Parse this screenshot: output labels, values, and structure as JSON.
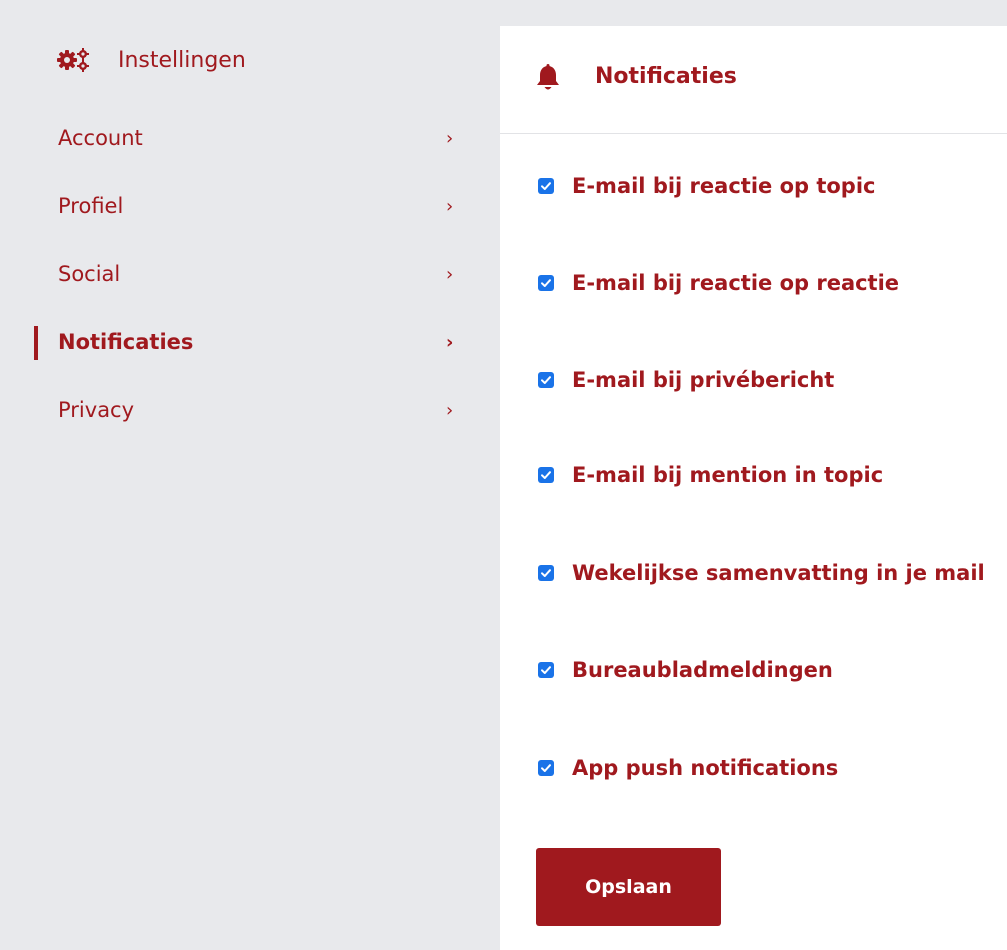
{
  "sidebar": {
    "header": {
      "icon": "gears-icon",
      "title": "Instellingen"
    },
    "items": [
      {
        "label": "Account",
        "chevron": "›",
        "active": false
      },
      {
        "label": "Profiel",
        "chevron": "›",
        "active": false
      },
      {
        "label": "Social",
        "chevron": "›",
        "active": false
      },
      {
        "label": "Notificaties",
        "chevron": "›",
        "active": true
      },
      {
        "label": "Privacy",
        "chevron": "›",
        "active": false
      }
    ]
  },
  "panel": {
    "header": {
      "icon": "bell-icon",
      "title": "Notificaties"
    },
    "options": [
      {
        "label": "E-mail bij reactie op topic",
        "checked": true
      },
      {
        "label": "E-mail bij reactie op reactie",
        "checked": true
      },
      {
        "label": "E-mail bij privébericht",
        "checked": true
      },
      {
        "label": "E-mail bij mention in topic",
        "checked": true
      },
      {
        "label": "Wekelijkse samenvatting in je mail",
        "checked": true
      },
      {
        "label": "Bureaubladmeldingen",
        "checked": true
      },
      {
        "label": "App push notifications",
        "checked": true
      }
    ],
    "save_label": "Opslaan"
  },
  "colors": {
    "brand": "#a0191e",
    "checkbox": "#1a73e8",
    "sidebar_bg": "#e8e9ec",
    "panel_bg": "#ffffff"
  }
}
